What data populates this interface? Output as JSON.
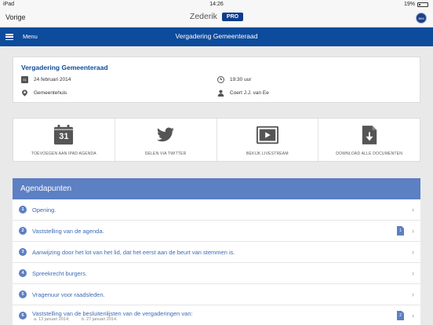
{
  "status": {
    "carrier": "iPad",
    "time": "14:26",
    "battery": "19%"
  },
  "nav": {
    "back": "Vorige",
    "title": "Zederik",
    "badge": "PRO",
    "logo_text": "BIM"
  },
  "header": {
    "menu": "Menu",
    "title": "Vergadering Gemeenteraad"
  },
  "meeting": {
    "title": "Vergadering Gemeenteraad",
    "date": "24 februari 2014",
    "date_icon_text": "31",
    "time": "19:30 uur",
    "location": "Gemeentehuis",
    "chair": "Coert J.J. van Ee"
  },
  "actions": [
    {
      "label": "TOEVOEGEN AAN IPAD AGENDA",
      "icon": "calendar-icon",
      "icon_text": "31"
    },
    {
      "label": "DELEN VIA TWITTER",
      "icon": "twitter-icon"
    },
    {
      "label": "BEKIJK LIVESTREAM",
      "icon": "play-icon"
    },
    {
      "label": "DOWNLOAD ALLE DOCUMENTEN",
      "icon": "download-icon"
    }
  ],
  "agenda": {
    "title": "Agendapunten",
    "items": [
      {
        "num": "1",
        "text": "Opening."
      },
      {
        "num": "2",
        "text": "Vaststelling van de agenda.",
        "docs": "1"
      },
      {
        "num": "3",
        "text": "Aanwijzing door het lot van het lid, dat het eerst aan de beurt van stemmen is."
      },
      {
        "num": "4",
        "text": "Spreekrecht burgers."
      },
      {
        "num": "5",
        "text": "Vragenuur voor raadsleden."
      },
      {
        "num": "6",
        "text": "Vaststelling van de besluitenlijsten van de vergaderingen van:",
        "sub_a": "a. 13 januari 2014;",
        "sub_b": "b. 27 januari 2014.",
        "docs": "2"
      }
    ]
  },
  "colors": {
    "brand": "#0d4b9c",
    "agenda_blue": "#5d7fc3"
  }
}
